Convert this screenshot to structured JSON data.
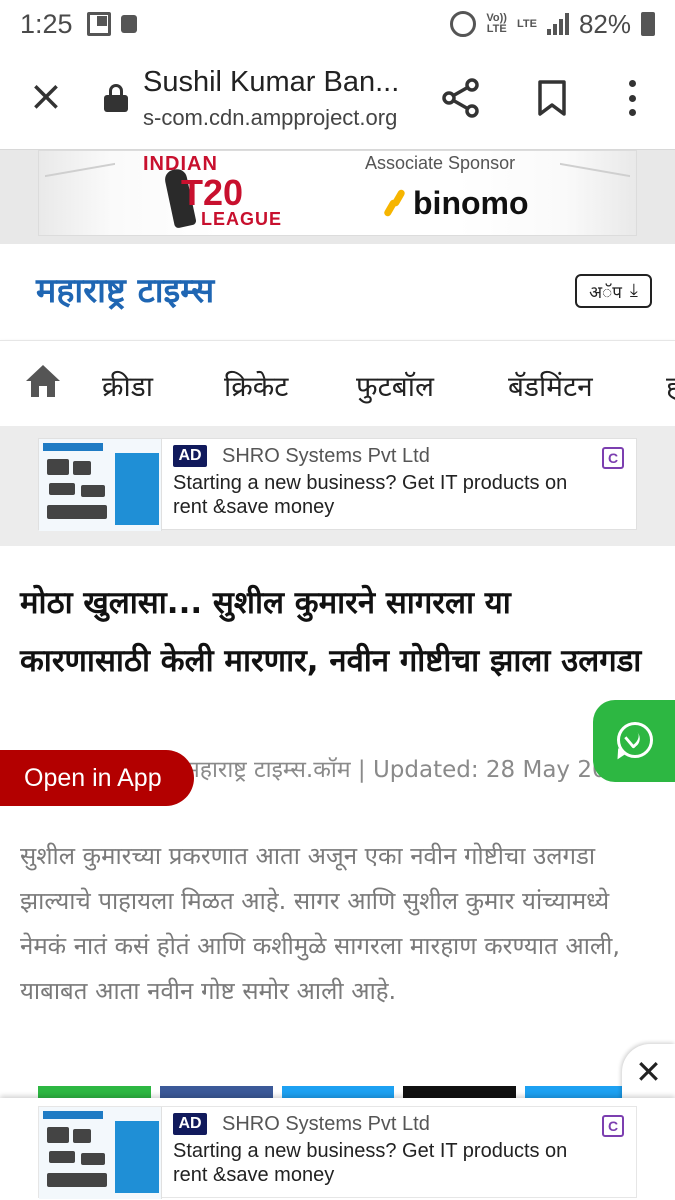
{
  "status_bar": {
    "time": "1:25",
    "volte": "Vo))",
    "volte_sub": "LTE",
    "lte": "LTE",
    "battery": "82%"
  },
  "toolbar": {
    "page_title": "Sushil Kumar Ban...",
    "url": "s-com.cdn.ampproject.org"
  },
  "sponsor": {
    "league_line1": "INDIAN",
    "league_line2": "T20",
    "league_line3": "LEAGUE",
    "associate_label": "Associate Sponsor",
    "sponsor_name": "binomo"
  },
  "masthead": {
    "logo": "महाराष्ट्र टाइम्स",
    "app_button": "अॅप"
  },
  "nav": {
    "items": [
      "क्रीडा",
      "क्रिकेट",
      "फुटबॉल",
      "बॅडमिंटन",
      "ह"
    ]
  },
  "ad": {
    "tag": "AD",
    "advertiser": "SHRO Systems Pvt Ltd",
    "text": "Starting a new business? Get IT products on rent &save money",
    "choice_icon": "C"
  },
  "article": {
    "headline": "मोठा खुलासा... सुशील कुमारने सागरला या कारणासाठी केली मारणार, नवीन गोष्टीचा झाला उलगडा",
    "byline": "महाराष्ट्र टाइम्स.कॉम | Updated: 28 May 2021",
    "body": "सुशील कुमारच्या प्रकरणात आता अजून एका नवीन गोष्टीचा उलगडा झाल्याचे पाहायला मिळत आहे. सागर आणि सुशील कुमार यांच्यामध्ये नेमकं नातं कसं होतं आणि कशीमुळे सागरला मारहाण करण्यात आली, याबाबत आता नवीन गोष्ट समोर आली आहे."
  },
  "floating": {
    "open_app": "Open in App",
    "close": "✕"
  },
  "sticky_ad": {
    "tag": "AD",
    "advertiser": "SHRO Systems Pvt Ltd",
    "text": "Starting a new business? Get IT products on rent &save money",
    "choice_icon": "C"
  },
  "colors": {
    "logo_blue": "#1f66b3",
    "open_app_red": "#b30000",
    "whatsapp_green": "#2db742",
    "league_red": "#c8102e",
    "binomo_yellow": "#f6b500",
    "share_colors": [
      "#2db742",
      "#3b5998",
      "#1da1f2",
      "#111111",
      "#1da1f2"
    ]
  }
}
